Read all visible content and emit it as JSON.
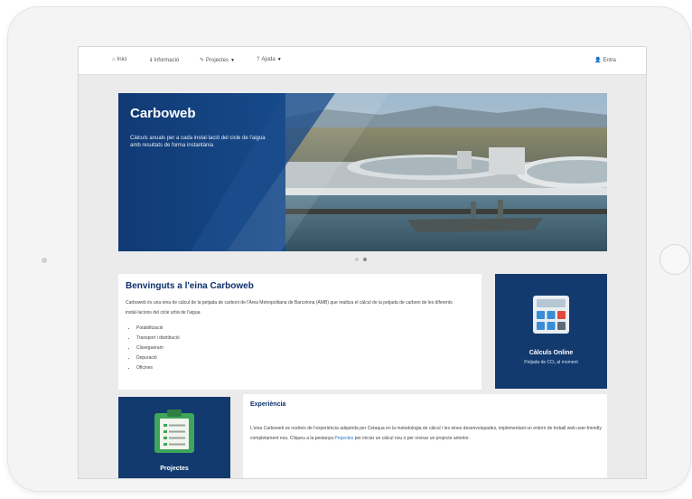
{
  "nav": {
    "home": "Inici",
    "info": "Informació",
    "projects": "Projectes",
    "help": "Ajuda",
    "login": "Entra"
  },
  "slide": {
    "title": "Carboweb",
    "text": "Càlculs anuals per a cada instal·lació del cicle de l'aigua amb resultats de forma instantània"
  },
  "welcome": {
    "title": "Benvinguts a l'eina Carboweb",
    "intro": "Carboweb és una eina de càlcul de la petjada de carboni de l'Àrea Metropolitana de Barcelona (AMB) que realitza el càlcul de la petjada de carboni de les diferents instal·lacions del cicle urbà de l'aigua.",
    "items": [
      "Potabilització",
      "Transport i distribució",
      "Clavegueram",
      "Depuració",
      "Oficines"
    ]
  },
  "online": {
    "title": "Càlculs Online",
    "subtitle": "Petjada de CO₂ al moment"
  },
  "projects_card": {
    "title": "Projectes"
  },
  "experience": {
    "title": "Experiència",
    "text_before": "L'eina Carboweb es nodreix de l'experiència adquirida per Cetaqua en la metodologia de càlcul i les eines desenvolupades, implementant un entorn de treball web user-friendly completament nou. Cliqueu a la pestanya",
    "link": "Projectes",
    "text_after": "per iniciar un càlcul nou o per revisar un projecte anterior."
  },
  "colors": {
    "primary": "#123a6e",
    "title": "#0c2f6b",
    "link": "#2a6fbf"
  }
}
